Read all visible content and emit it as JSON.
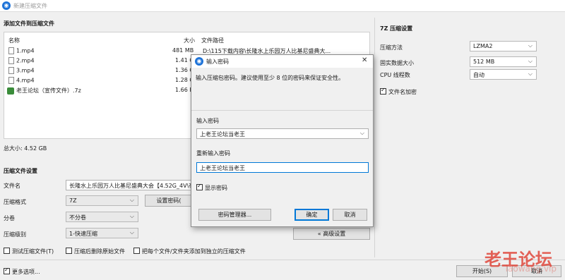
{
  "window": {
    "title": "新建压缩文件",
    "icon": "app-icon"
  },
  "files_section": {
    "title": "添加文件到压缩文件",
    "columns": [
      "名称",
      "大小",
      "文件路径"
    ],
    "rows": [
      {
        "name": "1.mp4",
        "size": "481 MB",
        "path": "D:\\115下载内容\\长隆水上乐园万人比基尼盛典大...",
        "icon": "file-icon"
      },
      {
        "name": "2.mp4",
        "size": "1.41 G",
        "path": "",
        "icon": "file-icon"
      },
      {
        "name": "3.mp4",
        "size": "1.36 G",
        "path": "",
        "icon": "file-icon"
      },
      {
        "name": "4.mp4",
        "size": "1.28 G",
        "path": "",
        "icon": "file-icon"
      },
      {
        "name": "老王论坛（宣传文件）.7z",
        "size": "1.66 K",
        "path": "",
        "icon": "archive-icon"
      }
    ],
    "total": "总大小: 4.52 GB"
  },
  "settings": {
    "title": "压缩文件设置",
    "filename_label": "文件名",
    "filename_value": "长隆水上乐园万人比基尼盛典大会【4.52G_4V\\在",
    "format_label": "压缩格式",
    "format_value": "7Z",
    "set_password_button": "设置密码(",
    "split_label": "分卷",
    "split_value": "不分卷",
    "level_label": "压缩级别",
    "level_value": "1-快速压缩",
    "advanced_button": "« 高级设置"
  },
  "checkboxes": {
    "test": "测试压缩文件(T)",
    "delete_source": "压缩后删除原始文件",
    "separate": "把每个文件/文件夹添加到独立的压缩文件",
    "more_options": "更多选项..."
  },
  "bottom": {
    "start_button": "开始(S)",
    "cancel_button": "取消"
  },
  "sevenz": {
    "title": "7Z 压缩设置",
    "method_label": "压缩方法",
    "method_value": "LZMA2",
    "dict_label": "固实数据大小",
    "dict_value": "512 MB",
    "threads_label": "CPU 线程数",
    "threads_value": "自动",
    "encrypt_names_label": "文件名加密"
  },
  "dialog": {
    "title": "输入密码",
    "close": "✕",
    "message": "输入压缩包密码。建议使用至少 8 位的密码来保证安全性。",
    "password_label": "输入密码",
    "password_value": "上老王论坛当老王",
    "confirm_label": "重新输入密码",
    "confirm_value": "上老王论坛当老王",
    "show_password_label": "显示密码",
    "manager_button": "密码管理器...",
    "ok_button": "确定",
    "cancel_button": "取消"
  },
  "watermark": {
    "text": "老王论坛",
    "sub": "laowang.vip"
  },
  "glyphs": {
    "dropdown": "⌵",
    "app": "◉"
  }
}
